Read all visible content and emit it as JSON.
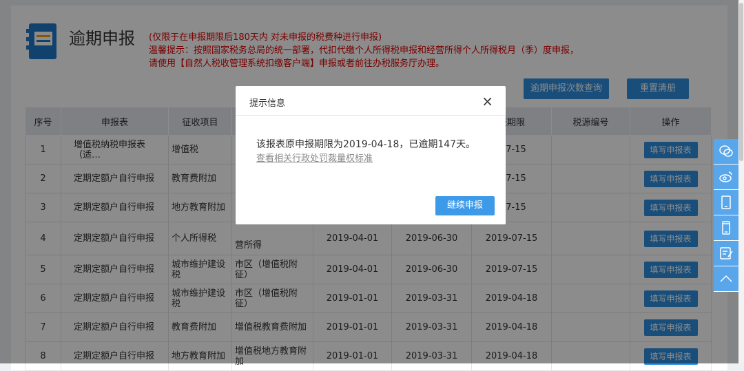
{
  "header": {
    "title": "逾期申报",
    "subtitle": "(仅限于在申报期限后180天内 对未申报的税费种进行申报)",
    "tip_line1": "温馨提示：按照国家税务总局的统一部署，代扣代缴个人所得税申报和经营所得个人所得税月（季）度申报，",
    "tip_line2": "请使用【自然人税收管理系统扣缴客户端】申报或者前往办税服务厅办理。",
    "query_button": "逾期申报次数查询",
    "reset_button": "重置清册"
  },
  "table": {
    "columns": [
      "序号",
      "申报表",
      "征收项目",
      "",
      "",
      "",
      "报期限",
      "税源编号",
      "操作"
    ],
    "operation_label": "填写申报表",
    "rows": [
      {
        "no": "1",
        "form": "增值税纳税申报表（适…",
        "item": "增值税",
        "detail": "",
        "start": "",
        "end": "",
        "deadline": "-07-15"
      },
      {
        "no": "2",
        "form": "定期定额户自行申报",
        "item": "教育费附加",
        "detail": "",
        "start": "",
        "end": "",
        "deadline": "-07-15"
      },
      {
        "no": "3",
        "form": "定期定额户自行申报",
        "item": "地方教育附加",
        "detail": "",
        "start": "",
        "end": "",
        "deadline": "-07-15"
      },
      {
        "no": "4",
        "form": "定期定额户自行申报",
        "item": "个人所得税",
        "detail": "营所得",
        "start": "2019-04-01",
        "end": "2019-06-30",
        "deadline": "2019-07-15"
      },
      {
        "no": "5",
        "form": "定期定额户自行申报",
        "item": "城市维护建设税",
        "detail": "市区（增值税附征）",
        "start": "2019-04-01",
        "end": "2019-06-30",
        "deadline": "2019-07-15"
      },
      {
        "no": "6",
        "form": "定期定额户自行申报",
        "item": "城市维护建设税",
        "detail": "市区（增值税附征）",
        "start": "2019-01-01",
        "end": "2019-03-31",
        "deadline": "2019-04-18"
      },
      {
        "no": "7",
        "form": "定期定额户自行申报",
        "item": "教育费附加",
        "detail": "增值税教育费附加",
        "start": "2019-01-01",
        "end": "2019-03-31",
        "deadline": "2019-04-18"
      },
      {
        "no": "8",
        "form": "定期定额户自行申报",
        "item": "地方教育附加",
        "detail": "增值税地方教育附加",
        "start": "2019-01-01",
        "end": "2019-03-31",
        "deadline": "2019-04-18"
      }
    ]
  },
  "modal": {
    "title": "提示信息",
    "close": "×",
    "message": "该报表原申报期限为2019-04-18，已逾期147天。",
    "link": "查看相关行政处罚裁量权标准",
    "continue_button": "继续申报"
  },
  "sidebar": {
    "icons": [
      "wechat-icon",
      "weibo-icon",
      "tablet-icon",
      "mobile-icon",
      "edit-icon",
      "back-to-top-icon"
    ]
  },
  "colors": {
    "accent": "#2f8fe0",
    "warning": "#dd0000"
  }
}
